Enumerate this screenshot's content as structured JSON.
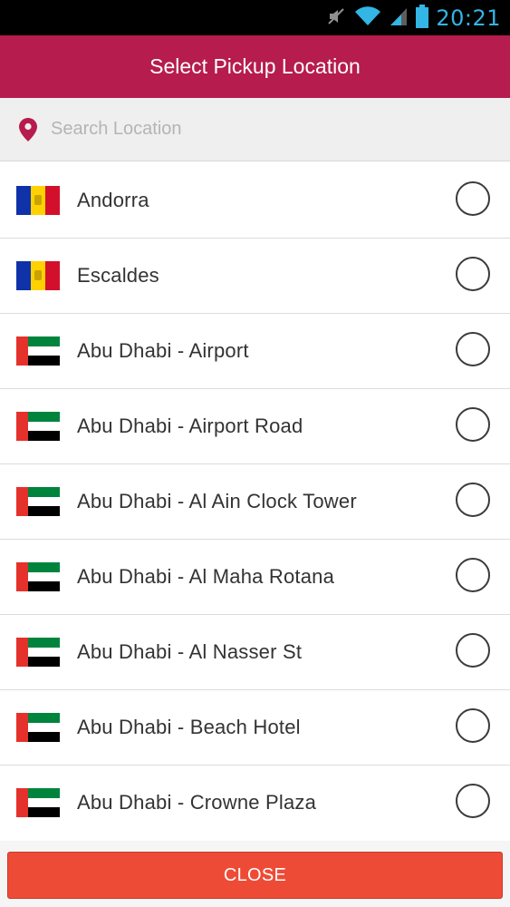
{
  "status_bar": {
    "time": "20:21",
    "icons": [
      "mute-icon",
      "wifi-icon",
      "signal-icon",
      "battery-icon"
    ],
    "time_color": "#33b5e5"
  },
  "header": {
    "title": "Select Pickup Location",
    "background": "#b61c4d"
  },
  "search": {
    "placeholder": "Search Location",
    "value": "",
    "icon": "location-pin-icon"
  },
  "locations": [
    {
      "label": "Andorra",
      "flag": "andorra",
      "selected": false
    },
    {
      "label": "Escaldes",
      "flag": "andorra",
      "selected": false
    },
    {
      "label": "Abu Dhabi - Airport",
      "flag": "uae",
      "selected": false
    },
    {
      "label": "Abu Dhabi - Airport Road",
      "flag": "uae",
      "selected": false
    },
    {
      "label": "Abu Dhabi - Al Ain Clock Tower",
      "flag": "uae",
      "selected": false
    },
    {
      "label": "Abu Dhabi - Al Maha Rotana",
      "flag": "uae",
      "selected": false
    },
    {
      "label": "Abu Dhabi - Al Nasser St",
      "flag": "uae",
      "selected": false
    },
    {
      "label": "Abu Dhabi - Beach Hotel",
      "flag": "uae",
      "selected": false
    },
    {
      "label": "Abu Dhabi - Crowne Plaza",
      "flag": "uae",
      "selected": false
    }
  ],
  "footer": {
    "close_label": "CLOSE",
    "button_color": "#ee4b37"
  }
}
